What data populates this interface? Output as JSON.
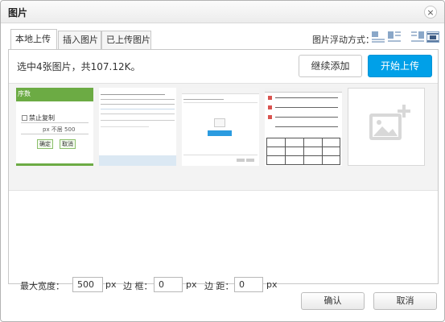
{
  "dialog": {
    "title": "图片",
    "close_glyph": "×"
  },
  "tabs": [
    {
      "label": "本地上传",
      "active": true
    },
    {
      "label": "插入图片",
      "active": false
    },
    {
      "label": "已上传图片",
      "active": false
    }
  ],
  "float": {
    "label": "图片浮动方式：",
    "options": [
      "float-none-icon",
      "float-left-icon",
      "float-right-icon",
      "float-center-icon"
    ]
  },
  "upload": {
    "status": "选中4张图片，共107.12K。",
    "continue_label": "继续添加",
    "start_label": "开始上传",
    "accent": "#00a0e8"
  },
  "thumbnails": [
    {
      "name": "dialog-screenshot",
      "texts": [
        "序数",
        "禁止复制",
        "px 不居 500",
        "确定",
        "取消"
      ]
    },
    {
      "name": "table-screenshot"
    },
    {
      "name": "upload-screenshot"
    },
    {
      "name": "calendar-screenshot"
    }
  ],
  "props": {
    "width_label": "最大宽度：",
    "width_value": "500",
    "width_unit": "px",
    "border_label": "边 框：",
    "border_value": "0",
    "border_unit": "px",
    "margin_label": "边 距：",
    "margin_value": "0",
    "margin_unit": "px"
  },
  "footer": {
    "ok_label": "确认",
    "cancel_label": "取消"
  }
}
